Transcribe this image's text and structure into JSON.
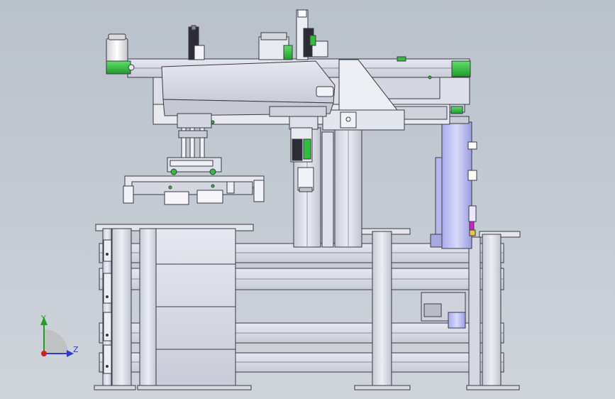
{
  "viewport": {
    "background_top": "#b9c1cb",
    "background_bottom": "#cfd4da"
  },
  "model": {
    "frame_color": "#d8dbe6",
    "frame_edge": "#3a3a44",
    "rail_color": "#e4e6ec",
    "accent_green": "#2fbf3a",
    "accent_blue": "#8f93d8",
    "accent_magenta": "#d020c8"
  },
  "triad": {
    "y_label": "Y",
    "z_label": "Z",
    "y_color": "#2a9a2a",
    "z_color": "#2a3bd0",
    "x_color": "#d02020"
  }
}
